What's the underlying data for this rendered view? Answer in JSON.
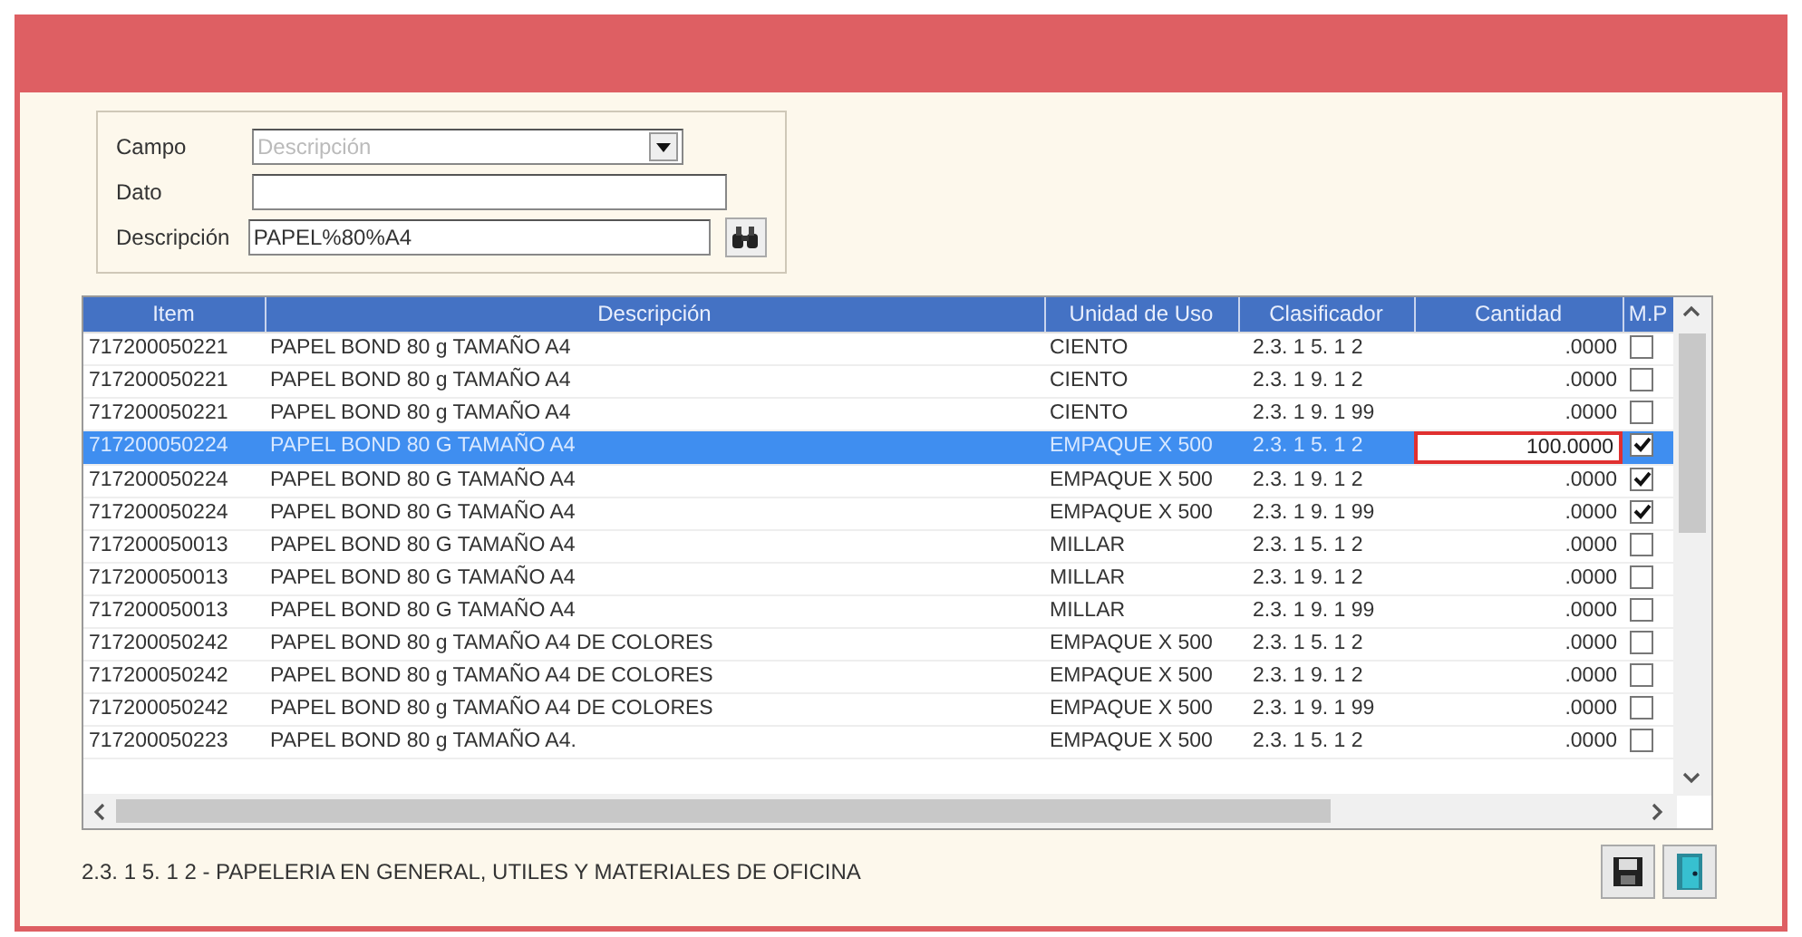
{
  "search": {
    "fields": [
      {
        "label": "Campo",
        "kind": "dropdown",
        "value": "Descripción",
        "disabled": true
      },
      {
        "label": "Dato",
        "kind": "text"
      },
      {
        "label": "Descripción",
        "kind": "search",
        "value": "PAPEL%80%A4"
      }
    ]
  },
  "table": {
    "columns": [
      "Item",
      "Descripción",
      "Unidad de Uso",
      "Clasificador",
      "Cantidad",
      "M.P"
    ],
    "rows": [
      {
        "item": "717200050221",
        "descripcion": "PAPEL BOND 80 g  TAMAÑO A4",
        "unidad": "CIENTO",
        "clasificador": "2.3. 1 5. 1 2",
        "cantidad": ".0000",
        "mp": false,
        "selected": false,
        "editing": false
      },
      {
        "item": "717200050221",
        "descripcion": "PAPEL BOND 80 g  TAMAÑO A4",
        "unidad": "CIENTO",
        "clasificador": "2.3. 1 9. 1 2",
        "cantidad": ".0000",
        "mp": false,
        "selected": false,
        "editing": false
      },
      {
        "item": "717200050221",
        "descripcion": "PAPEL BOND 80 g  TAMAÑO A4",
        "unidad": "CIENTO",
        "clasificador": "2.3. 1 9. 1 99",
        "cantidad": ".0000",
        "mp": false,
        "selected": false,
        "editing": false
      },
      {
        "item": "717200050224",
        "descripcion": "PAPEL BOND 80 G TAMAÑO  A4",
        "unidad": "EMPAQUE X 500",
        "clasificador": "2.3. 1 5. 1 2",
        "cantidad": "100.0000",
        "mp": true,
        "selected": true,
        "editing": true
      },
      {
        "item": "717200050224",
        "descripcion": "PAPEL BOND 80 G TAMAÑO  A4",
        "unidad": "EMPAQUE X 500",
        "clasificador": "2.3. 1 9. 1 2",
        "cantidad": ".0000",
        "mp": true,
        "selected": false,
        "editing": false
      },
      {
        "item": "717200050224",
        "descripcion": "PAPEL BOND 80 G TAMAÑO  A4",
        "unidad": "EMPAQUE X 500",
        "clasificador": "2.3. 1 9. 1 99",
        "cantidad": ".0000",
        "mp": true,
        "selected": false,
        "editing": false
      },
      {
        "item": "717200050013",
        "descripcion": "PAPEL BOND 80 G TAMAÑO A4",
        "unidad": "MILLAR",
        "clasificador": "2.3. 1 5. 1 2",
        "cantidad": ".0000",
        "mp": false,
        "selected": false,
        "editing": false
      },
      {
        "item": "717200050013",
        "descripcion": "PAPEL BOND 80 G TAMAÑO A4",
        "unidad": "MILLAR",
        "clasificador": "2.3. 1 9. 1 2",
        "cantidad": ".0000",
        "mp": false,
        "selected": false,
        "editing": false
      },
      {
        "item": "717200050013",
        "descripcion": "PAPEL BOND 80 G TAMAÑO A4",
        "unidad": "MILLAR",
        "clasificador": "2.3. 1 9. 1 99",
        "cantidad": ".0000",
        "mp": false,
        "selected": false,
        "editing": false
      },
      {
        "item": "717200050242",
        "descripcion": "PAPEL BOND 80 g TAMAÑO A4 DE COLORES",
        "unidad": "EMPAQUE X 500",
        "clasificador": "2.3. 1 5. 1 2",
        "cantidad": ".0000",
        "mp": false,
        "selected": false,
        "editing": false
      },
      {
        "item": "717200050242",
        "descripcion": "PAPEL BOND 80 g TAMAÑO A4 DE COLORES",
        "unidad": "EMPAQUE X 500",
        "clasificador": "2.3. 1 9. 1 2",
        "cantidad": ".0000",
        "mp": false,
        "selected": false,
        "editing": false
      },
      {
        "item": "717200050242",
        "descripcion": "PAPEL BOND 80 g TAMAÑO A4 DE COLORES",
        "unidad": "EMPAQUE X 500",
        "clasificador": "2.3. 1 9. 1 99",
        "cantidad": ".0000",
        "mp": false,
        "selected": false,
        "editing": false
      },
      {
        "item": "717200050223",
        "descripcion": "PAPEL BOND 80 g TAMAÑO A4.",
        "unidad": "EMPAQUE X 500",
        "clasificador": "2.3. 1 5. 1 2",
        "cantidad": ".0000",
        "mp": false,
        "selected": false,
        "editing": false
      }
    ]
  },
  "status_bar": {
    "text": "2.3. 1  5. 1  2 - PAPELERIA EN GENERAL, UTILES Y MATERIALES DE OFICINA"
  }
}
